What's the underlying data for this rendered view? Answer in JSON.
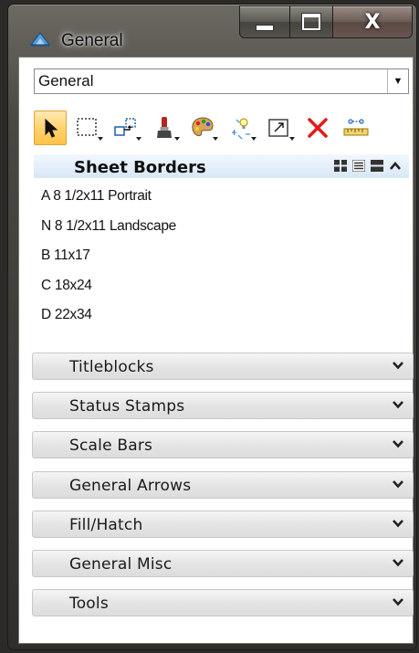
{
  "window": {
    "title": "General",
    "close_glyph": "X"
  },
  "dropdown": {
    "value": "General",
    "arrow_glyph": "▼"
  },
  "toolbar": {
    "tools": [
      {
        "icon": "select-arrow-icon",
        "active": true
      },
      {
        "icon": "selection-rectangle-icon",
        "active": false
      },
      {
        "icon": "manipulate-cells-icon",
        "active": false
      },
      {
        "icon": "paint-brush-icon",
        "active": false
      },
      {
        "icon": "palette-icon",
        "active": false
      },
      {
        "icon": "place-light-icon",
        "active": false
      },
      {
        "icon": "scale-icon",
        "active": false
      },
      {
        "icon": "delete-icon",
        "active": false
      },
      {
        "icon": "measure-icon",
        "active": false
      }
    ]
  },
  "open_section": {
    "title": "Sheet Borders",
    "items": [
      "A 8 1/2x11 Portrait",
      "N 8 1/2x11 Landscape",
      "B 11x17",
      "C 18x24",
      "D 22x34"
    ]
  },
  "sections": [
    "Titleblocks",
    "Status Stamps",
    "Scale Bars",
    "General Arrows",
    "Fill/Hatch",
    "General Misc",
    "Tools"
  ],
  "colors": {
    "active_tool": "#ffd36f",
    "header_open": "#d8e7f6",
    "delete_red": "#e11b1b"
  }
}
